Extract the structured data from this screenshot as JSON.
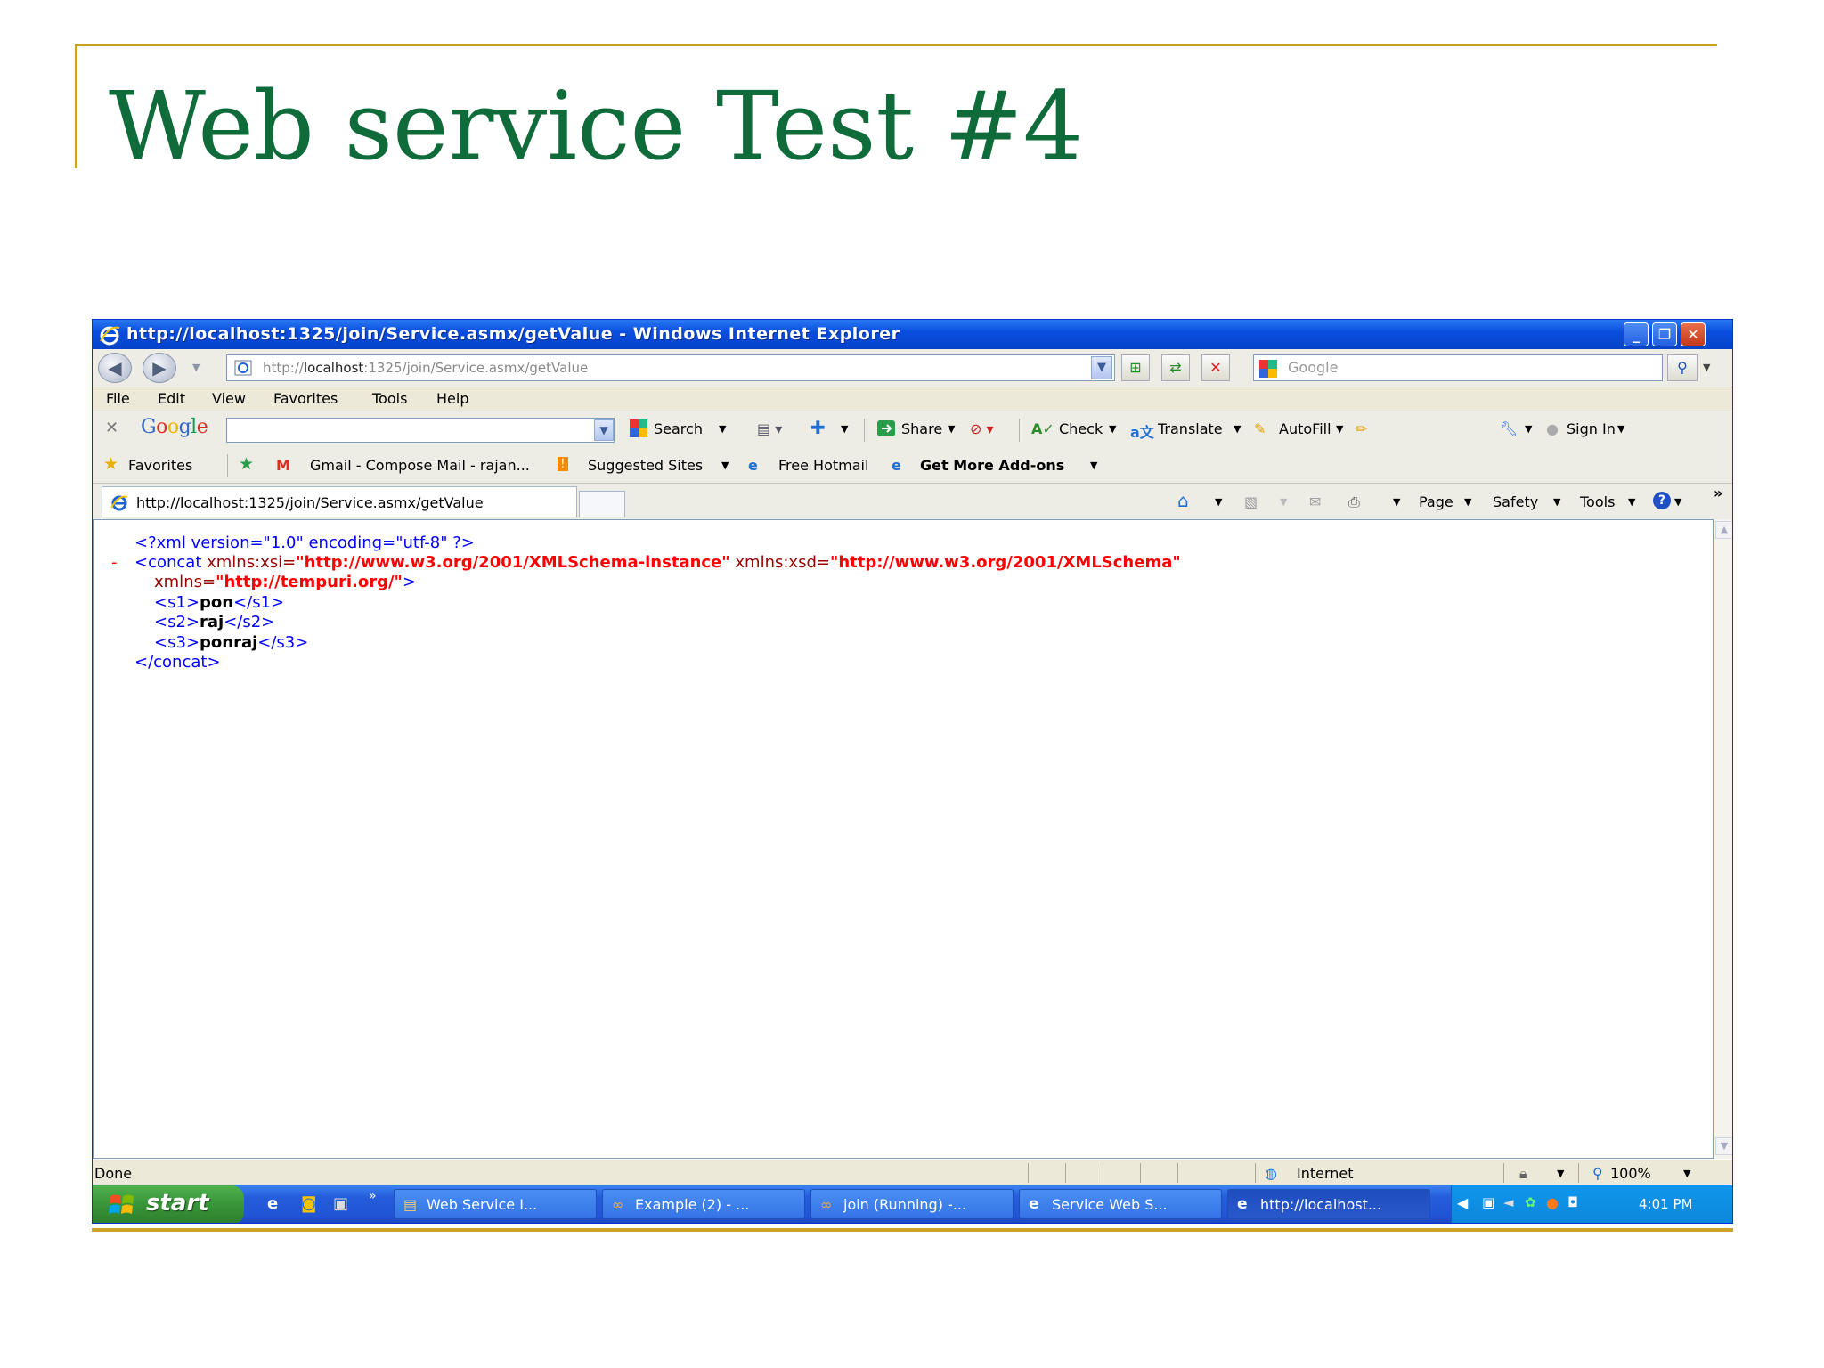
{
  "slide": {
    "title": "Web service Test #4"
  },
  "window": {
    "title": "http://localhost:1325/join/Service.asmx/getValue - Windows Internet Explorer",
    "minimize_glyph": "_",
    "restore_glyph": "❐",
    "close_glyph": "✕"
  },
  "address_bar": {
    "url_prefix": "http://",
    "url_host": "localhost",
    "url_rest": ":1325/join/Service.asmx/getValue",
    "search_placeholder": "Google"
  },
  "menu": [
    "File",
    "Edit",
    "View",
    "Favorites",
    "Tools",
    "Help"
  ],
  "google_toolbar": {
    "logo": "Google",
    "search_label": "Search",
    "share_label": "Share",
    "check_label": "Check",
    "translate_label": "Translate",
    "autofill_label": "AutoFill",
    "sign_in_label": "Sign In"
  },
  "favorites_bar": {
    "favorites_label": "Favorites",
    "items": [
      "Gmail - Compose Mail - rajan...",
      "Suggested Sites",
      "Free Hotmail",
      "Get More Add-ons"
    ]
  },
  "tab": {
    "title": "http://localhost:1325/join/Service.asmx/getValue"
  },
  "command_bar": {
    "page_label": "Page",
    "safety_label": "Safety",
    "tools_label": "Tools",
    "chevron": "»"
  },
  "xml": {
    "decl": "<?xml version=\"1.0\" encoding=\"utf-8\" ?>",
    "collapse": "-",
    "root_open": "<concat",
    "attr_xsi_name": " xmlns:xsi=",
    "attr_xsi_value": "\"http://www.w3.org/2001/XMLSchema-instance\"",
    "attr_xsd_name": " xmlns:xsd=",
    "attr_xsd_value": "\"http://www.w3.org/2001/XMLSchema\"",
    "attr_ns_name": "xmlns=",
    "attr_ns_value": "\"http://tempuri.org/\"",
    "close_bracket": ">",
    "s1_open": "<s1>",
    "s1_value": "pon",
    "s1_close": "</s1>",
    "s2_open": "<s2>",
    "s2_value": "raj",
    "s2_close": "</s2>",
    "s3_open": "<s3>",
    "s3_value": "ponraj",
    "s3_close": "</s3>",
    "root_close": "</concat>"
  },
  "status_bar": {
    "status": "Done",
    "zone": "Internet",
    "zoom": "100%"
  },
  "taskbar": {
    "start_label": "start",
    "items": [
      {
        "label": "Web Service I...",
        "active": false
      },
      {
        "label": "Example (2) - ...",
        "active": false
      },
      {
        "label": "join (Running) -...",
        "active": false
      },
      {
        "label": "Service Web S...",
        "active": false
      },
      {
        "label": "http://localhost...",
        "active": true
      }
    ],
    "clock": "4:01 PM"
  }
}
